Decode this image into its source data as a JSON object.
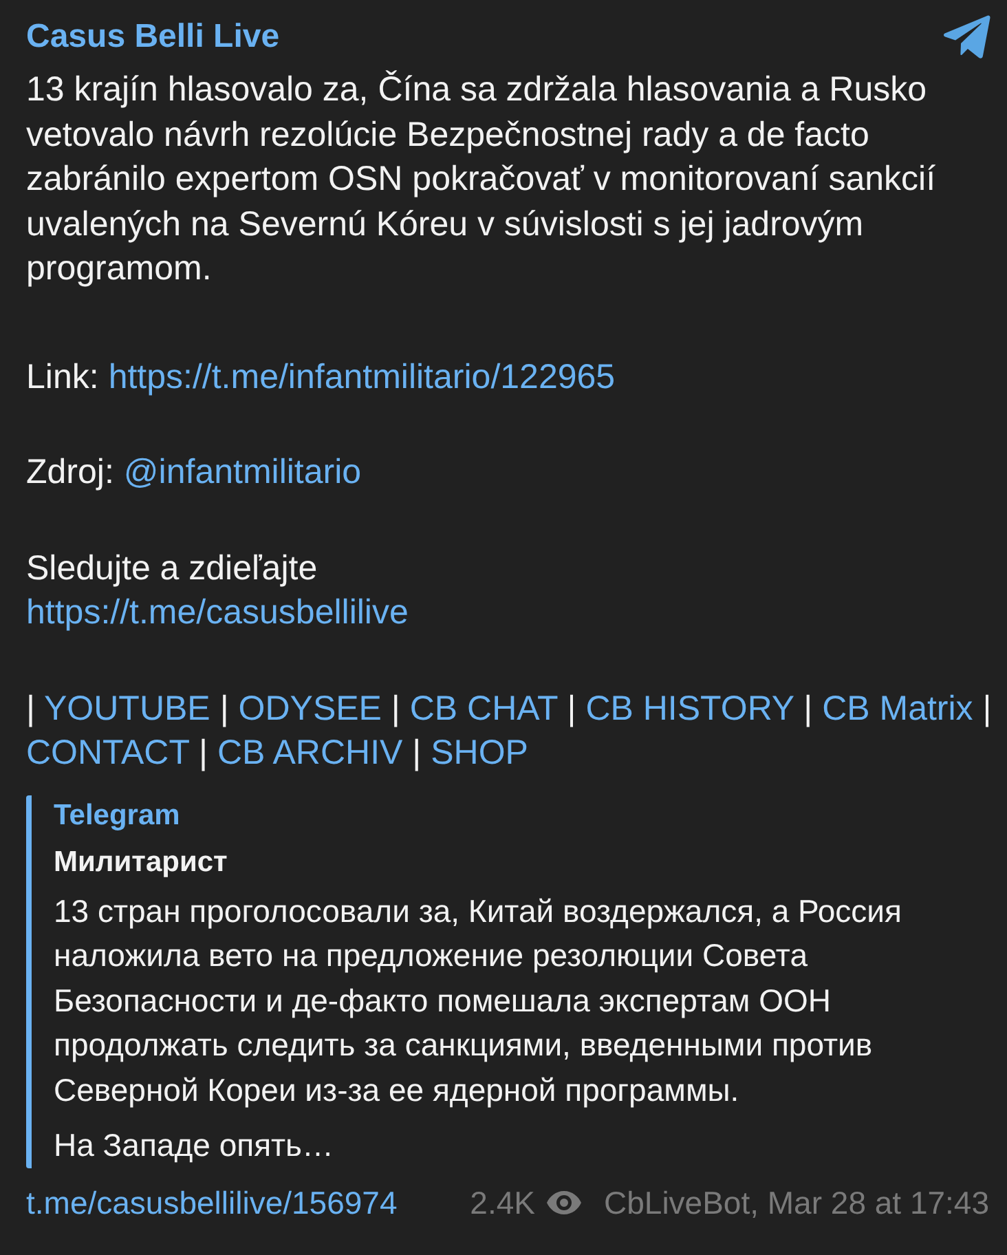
{
  "header": {
    "channel_name": "Casus Belli Live"
  },
  "message": [
    {
      "kind": "text",
      "text": "13 krajín hlasovalo za, Čína sa zdržala hlasovania a Rusko vetovalo návrh rezolúcie Bezpečnostnej rady a de facto zabránilo expertom OSN pokračovať v monitorovaní sankcií uvalených na Severnú Kóreu v súvislosti s jej jadrovým programom."
    },
    {
      "kind": "labeled_link",
      "label": "Link:",
      "link": "https://t.me/infantmilitario/122965"
    },
    {
      "kind": "labeled_link",
      "label": "Zdroj:",
      "link": "@infantmilitario"
    },
    {
      "kind": "caption_link",
      "text": "Sledujte a zdieľajte",
      "link": "https://t.me/casusbellilive"
    },
    {
      "kind": "link_bar",
      "items": [
        {
          "kind": "separator",
          "text": "|"
        },
        {
          "kind": "link",
          "text": "YOUTUBE"
        },
        {
          "kind": "separator",
          "text": "|"
        },
        {
          "kind": "link",
          "text": "ODYSEE"
        },
        {
          "kind": "separator",
          "text": "|"
        },
        {
          "kind": "link",
          "text": "CB CHAT"
        },
        {
          "kind": "separator",
          "text": "|"
        },
        {
          "kind": "link",
          "text": "CB HISTORY"
        },
        {
          "kind": "separator",
          "text": "|"
        },
        {
          "kind": "link",
          "text": "CB Matrix"
        },
        {
          "kind": "separator",
          "text": "|"
        },
        {
          "kind": "link",
          "text": "CONTACT"
        },
        {
          "kind": "separator",
          "text": "|"
        },
        {
          "kind": "link",
          "text": "CB ARCHIV"
        },
        {
          "kind": "separator",
          "text": "|"
        },
        {
          "kind": "link",
          "text": "SHOP"
        }
      ]
    }
  ],
  "quote": {
    "source": "Telegram",
    "author": "Милитарист",
    "paragraphs": [
      "13 стран проголосовали за, Китай воздержался, а Россия наложила вето на предложение резолюции Совета Безопасности и де-факто помешала экспертам ООН продолжать следить за санкциями, введенными против Северной Кореи из-за ее ядерной программы.",
      "На Западе опять…"
    ]
  },
  "footer": {
    "link": "t.me/casusbellilive/156974",
    "views": "2.4K",
    "signature": "CbLiveBot, Mar 28 at 17:43"
  }
}
